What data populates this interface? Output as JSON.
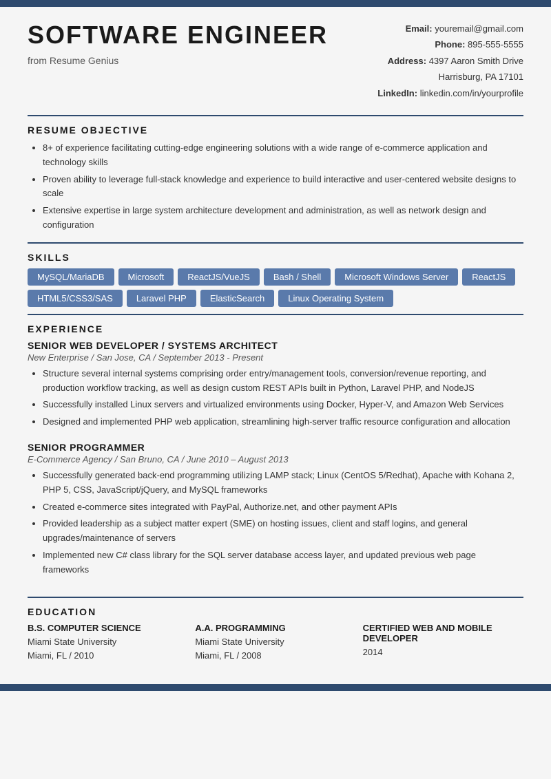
{
  "topBar": {},
  "header": {
    "name": "SOFTWARE ENGINEER",
    "subtitle": "from Resume Genius",
    "contact": {
      "emailLabel": "Email:",
      "emailValue": "youremail@gmail.com",
      "phoneLabel": "Phone:",
      "phoneValue": "895-555-5555",
      "addressLabel": "Address:",
      "addressLine1": "4397 Aaron Smith Drive",
      "addressLine2": "Harrisburg, PA 17101",
      "linkedinLabel": "LinkedIn:",
      "linkedinValue": "linkedin.com/in/yourprofile"
    }
  },
  "sections": {
    "objective": {
      "title": "RESUME OBJECTIVE",
      "bullets": [
        "8+ of experience facilitating cutting-edge engineering solutions with a wide range of e-commerce application and technology skills",
        "Proven ability to leverage full-stack knowledge and experience to build interactive and user-centered website designs to scale",
        "Extensive expertise in large system architecture development and administration, as well as network design and configuration"
      ]
    },
    "skills": {
      "title": "SKILLS",
      "badges": [
        "MySQL/MariaDB",
        "Microsoft",
        "ReactJS/VueJS",
        "Bash / Shell",
        "Microsoft Windows Server",
        "ReactJS",
        "HTML5/CSS3/SAS",
        "Laravel PHP",
        "ElasticSearch",
        "Linux Operating System"
      ]
    },
    "experience": {
      "title": "EXPERIENCE",
      "jobs": [
        {
          "title": "SENIOR WEB DEVELOPER / SYSTEMS ARCHITECT",
          "company": "New Enterprise / San Jose, CA / September 2013 - Present",
          "bullets": [
            "Structure several internal systems comprising order entry/management tools, conversion/revenue reporting, and production workflow tracking, as well as design custom REST APIs built in Python, Laravel PHP, and NodeJS",
            "Successfully installed Linux servers and virtualized environments using Docker, Hyper-V, and Amazon Web Services",
            "Designed and implemented PHP web application, streamlining high-server traffic resource configuration and allocation"
          ]
        },
        {
          "title": "SENIOR PROGRAMMER",
          "company": "E-Commerce Agency / San Bruno, CA / June 2010 – August 2013",
          "bullets": [
            "Successfully generated back-end programming utilizing LAMP stack; Linux (CentOS 5/Redhat), Apache with Kohana 2, PHP 5, CSS, JavaScript/jQuery, and MySQL frameworks",
            "Created e-commerce sites integrated with PayPal, Authorize.net, and other payment APIs",
            "Provided leadership as a subject matter expert (SME) on hosting issues, client and staff logins, and general upgrades/maintenance of servers",
            "Implemented new C# class library for the SQL server database access layer, and updated previous web page frameworks"
          ]
        }
      ]
    },
    "education": {
      "title": "EDUCATION",
      "items": [
        {
          "degree": "B.S. COMPUTER SCIENCE",
          "school": "Miami State University",
          "detail": "Miami, FL / 2010"
        },
        {
          "degree": "A.A. PROGRAMMING",
          "school": "Miami State University",
          "detail": "Miami, FL / 2008"
        },
        {
          "degree": "CERTIFIED WEB AND MOBILE DEVELOPER",
          "school": "",
          "detail": "2014"
        }
      ]
    }
  }
}
